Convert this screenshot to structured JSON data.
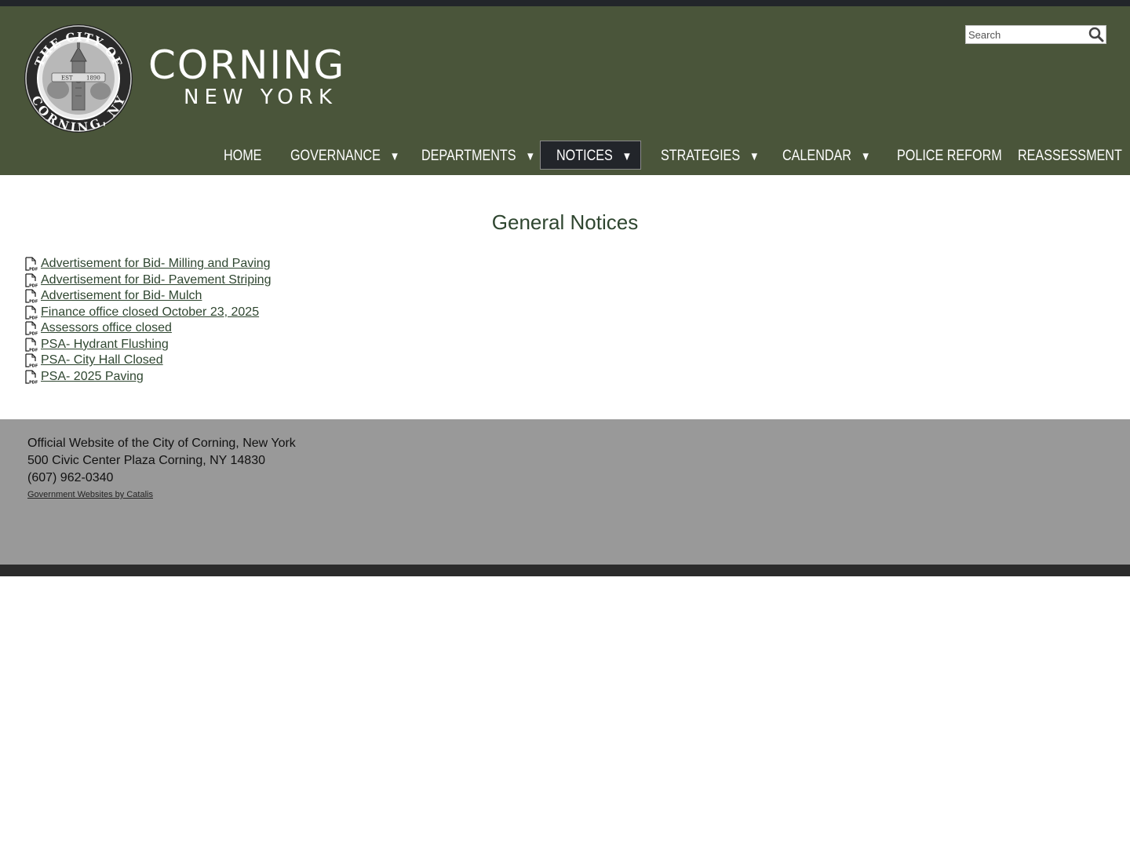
{
  "header": {
    "seal": {
      "top_text": "THE CITY OF",
      "bottom_text": "CORNING, NY",
      "est_label": "EST",
      "est_year": "1890"
    },
    "wordmark_main": "CORNING",
    "wordmark_sub": "NEW YORK",
    "search": {
      "placeholder": "Search"
    }
  },
  "nav": {
    "items": [
      {
        "label": "HOME",
        "dropdown": false
      },
      {
        "label": "GOVERNANCE",
        "dropdown": true
      },
      {
        "label": "DEPARTMENTS",
        "dropdown": true
      },
      {
        "label": "NOTICES",
        "dropdown": true,
        "active": true
      },
      {
        "label": "STRATEGIES",
        "dropdown": true
      },
      {
        "label": "CALENDAR",
        "dropdown": true
      },
      {
        "label": "POLICE REFORM",
        "dropdown": false
      },
      {
        "label": "REASSESSMENT",
        "dropdown": false
      }
    ],
    "caret": "▼"
  },
  "main": {
    "title": "General Notices",
    "notices": [
      "Advertisement for Bid- Milling and Paving",
      "Advertisement for Bid- Pavement Striping",
      "Advertisement for Bid- Mulch",
      "Finance office closed October 23, 2025",
      "Assessors office closed",
      "PSA- Hydrant Flushing",
      "PSA- City Hall Closed",
      "PSA- 2025 Paving"
    ],
    "file_icon": "pdf-file-icon"
  },
  "footer": {
    "line1": "Official Website of the City of Corning, New York",
    "line2": "500 Civic Center Plaza Corning, NY 14830",
    "line3": "(607) 962-0340",
    "credit": "Government Websites by Catalis"
  },
  "colors": {
    "header_bg": "#4a553a",
    "topbar": "#22252a",
    "nav_active_bg": "#22252a",
    "link": "#2f4630",
    "footer_bg": "#999999",
    "bottombar": "#2b2b2b"
  }
}
